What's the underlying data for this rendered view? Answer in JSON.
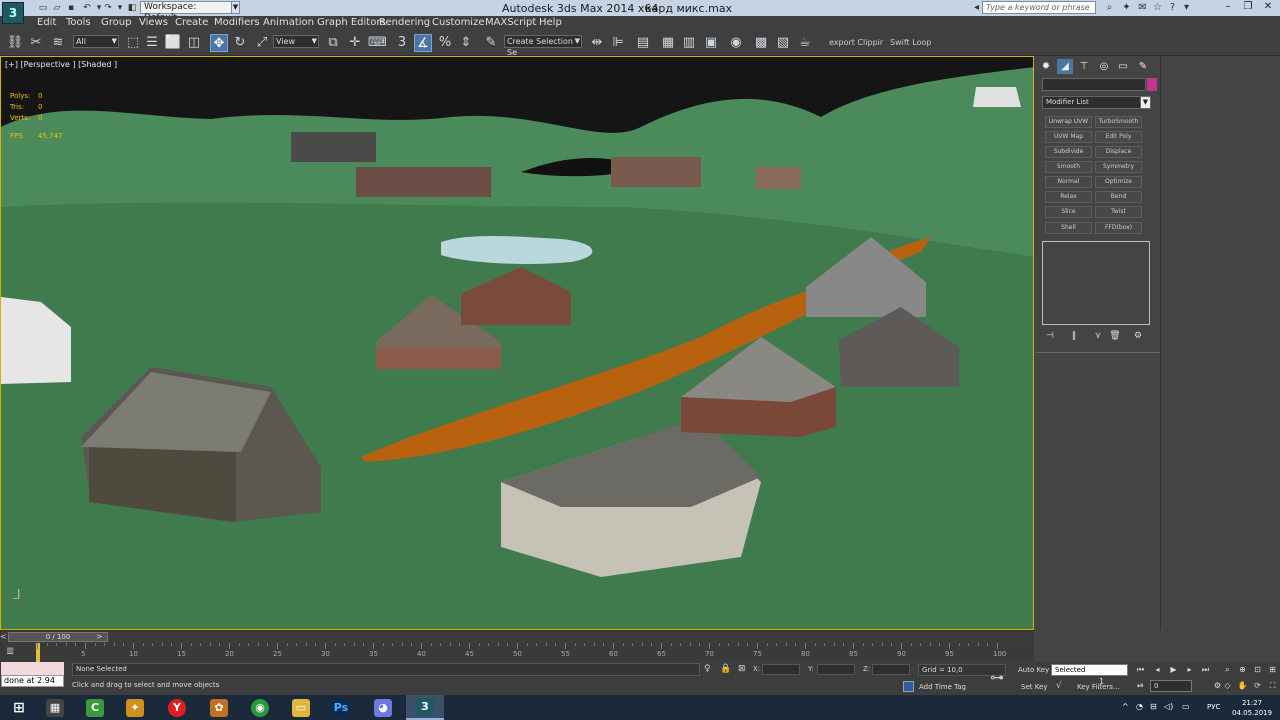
{
  "titlebar": {
    "workspace": "Workspace: Default",
    "app_title": "Autodesk 3ds Max  2014 x64",
    "file_title": "кард микс.max",
    "search_placeholder": "Type a keyword or phrase"
  },
  "menu": [
    "Edit",
    "Tools",
    "Group",
    "Views",
    "Create",
    "Modifiers",
    "Animation",
    "Graph Editors",
    "Rendering",
    "Customize",
    "MAXScript",
    "Help"
  ],
  "toolbar": {
    "filter": "All",
    "ref_coord": "View",
    "snap_label": "3",
    "selection_set": "Create Selection Se",
    "export_clipping": "export Clippir",
    "swift_loop": "Swift Loop"
  },
  "viewport": {
    "label": "[+] [Perspective ] [Shaded ]",
    "stats": [
      {
        "label": "Polys:",
        "value": "0"
      },
      {
        "label": "Tris:",
        "value": "0"
      },
      {
        "label": "Verts:",
        "value": "0"
      }
    ],
    "fps_label": "FPS:",
    "fps_value": "45,747",
    "colors": {
      "sky": "#151515",
      "ground": "#3e7a4c",
      "hill": "#4a8a58",
      "road": "#b8620f"
    }
  },
  "command_panel": {
    "modifier_list": "Modifier List",
    "buttons": [
      "Unwrap UVW",
      "TurboSmooth",
      "UVW Map",
      "Edit Poly",
      "Subdivide",
      "Displace",
      "Smooth",
      "Symmetry",
      "Normal",
      "Optimize",
      "Relax",
      "Bend",
      "Slice",
      "Twist",
      "Shell",
      "FFD(box)"
    ],
    "color_swatch": "#c8348c"
  },
  "timeline": {
    "slider": "0 / 100",
    "ticks": [
      "5",
      "10",
      "15",
      "20",
      "25",
      "30",
      "35",
      "40",
      "45",
      "50",
      "55",
      "60",
      "65",
      "70",
      "75",
      "80",
      "85",
      "90",
      "95",
      "100"
    ]
  },
  "status": {
    "maxscript": "done at 2.94",
    "selection": "None Selected",
    "prompt": "Click and drag to select and move objects",
    "x": "X:",
    "y": "Y:",
    "z": "Z:",
    "grid": "Grid = 10,0",
    "add_time_tag": "Add Time Tag",
    "auto_key": "Auto Key",
    "set_key": "Set Key",
    "selected": "Selected",
    "key_filters": "Key Filters...",
    "frame": "0",
    "frame_num": "1"
  },
  "taskbar": {
    "lang": "РУС",
    "time": "21:27",
    "date": "04.05.2019"
  }
}
